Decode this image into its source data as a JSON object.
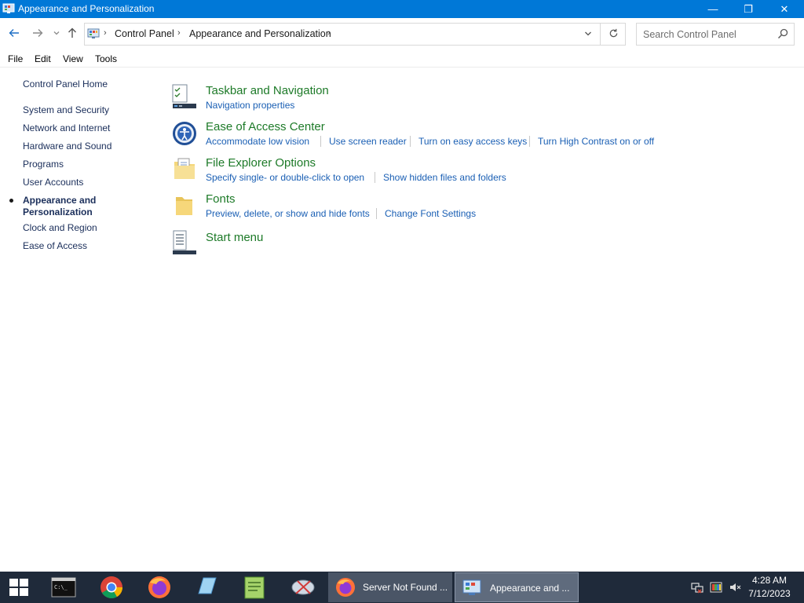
{
  "window": {
    "title": "Appearance and Personalization",
    "minimize_glyph": "—",
    "maximize_glyph": "❐",
    "close_glyph": "✕"
  },
  "nav": {
    "back_icon": "arrow-left-icon",
    "forward_icon": "arrow-right-icon",
    "up_icon": "arrow-up-icon",
    "breadcrumb": [
      "Control Panel",
      "Appearance and Personalization"
    ],
    "search_placeholder": "Search Control Panel"
  },
  "menu": [
    "File",
    "Edit",
    "View",
    "Tools"
  ],
  "sidebar": {
    "home": "Control Panel Home",
    "items": [
      "System and Security",
      "Network and Internet",
      "Hardware and Sound",
      "Programs",
      "User Accounts",
      "Appearance and Personalization",
      "Clock and Region",
      "Ease of Access"
    ],
    "active_index": 5
  },
  "categories": [
    {
      "title": "Taskbar and Navigation",
      "icon": "taskbar-icon",
      "links": [
        "Navigation properties"
      ]
    },
    {
      "title": "Ease of Access Center",
      "icon": "ease-of-access-icon",
      "links": [
        "Accommodate low vision",
        "Use screen reader",
        "Turn on easy access keys",
        "Turn High Contrast on or off"
      ]
    },
    {
      "title": "File Explorer Options",
      "icon": "folder-options-icon",
      "links": [
        "Specify single- or double-click to open",
        "Show hidden files and folders"
      ]
    },
    {
      "title": "Fonts",
      "icon": "fonts-folder-icon",
      "links": [
        "Preview, delete, or show and hide fonts",
        "Change Font Settings"
      ]
    },
    {
      "title": "Start menu",
      "icon": "start-menu-icon",
      "links": []
    }
  ],
  "taskbar": {
    "pinned": [
      "terminal-icon",
      "chrome-icon",
      "firefox-icon",
      "notepad-icon",
      "text-editor-icon",
      "snipping-tool-icon"
    ],
    "tasks": [
      {
        "label": "Server Not Found ...",
        "icon": "firefox-icon",
        "active": false
      },
      {
        "label": "Appearance and ...",
        "icon": "control-panel-icon",
        "active": true
      }
    ],
    "tray": [
      "network-icon",
      "color-icon",
      "volume-muted-icon"
    ],
    "time": "4:28 AM",
    "date": "7/12/2023"
  },
  "colors": {
    "titlebar": "#0078d7",
    "category_title": "#1d7a28",
    "link": "#1a5fb4",
    "taskbar": "#1f2a3a"
  }
}
